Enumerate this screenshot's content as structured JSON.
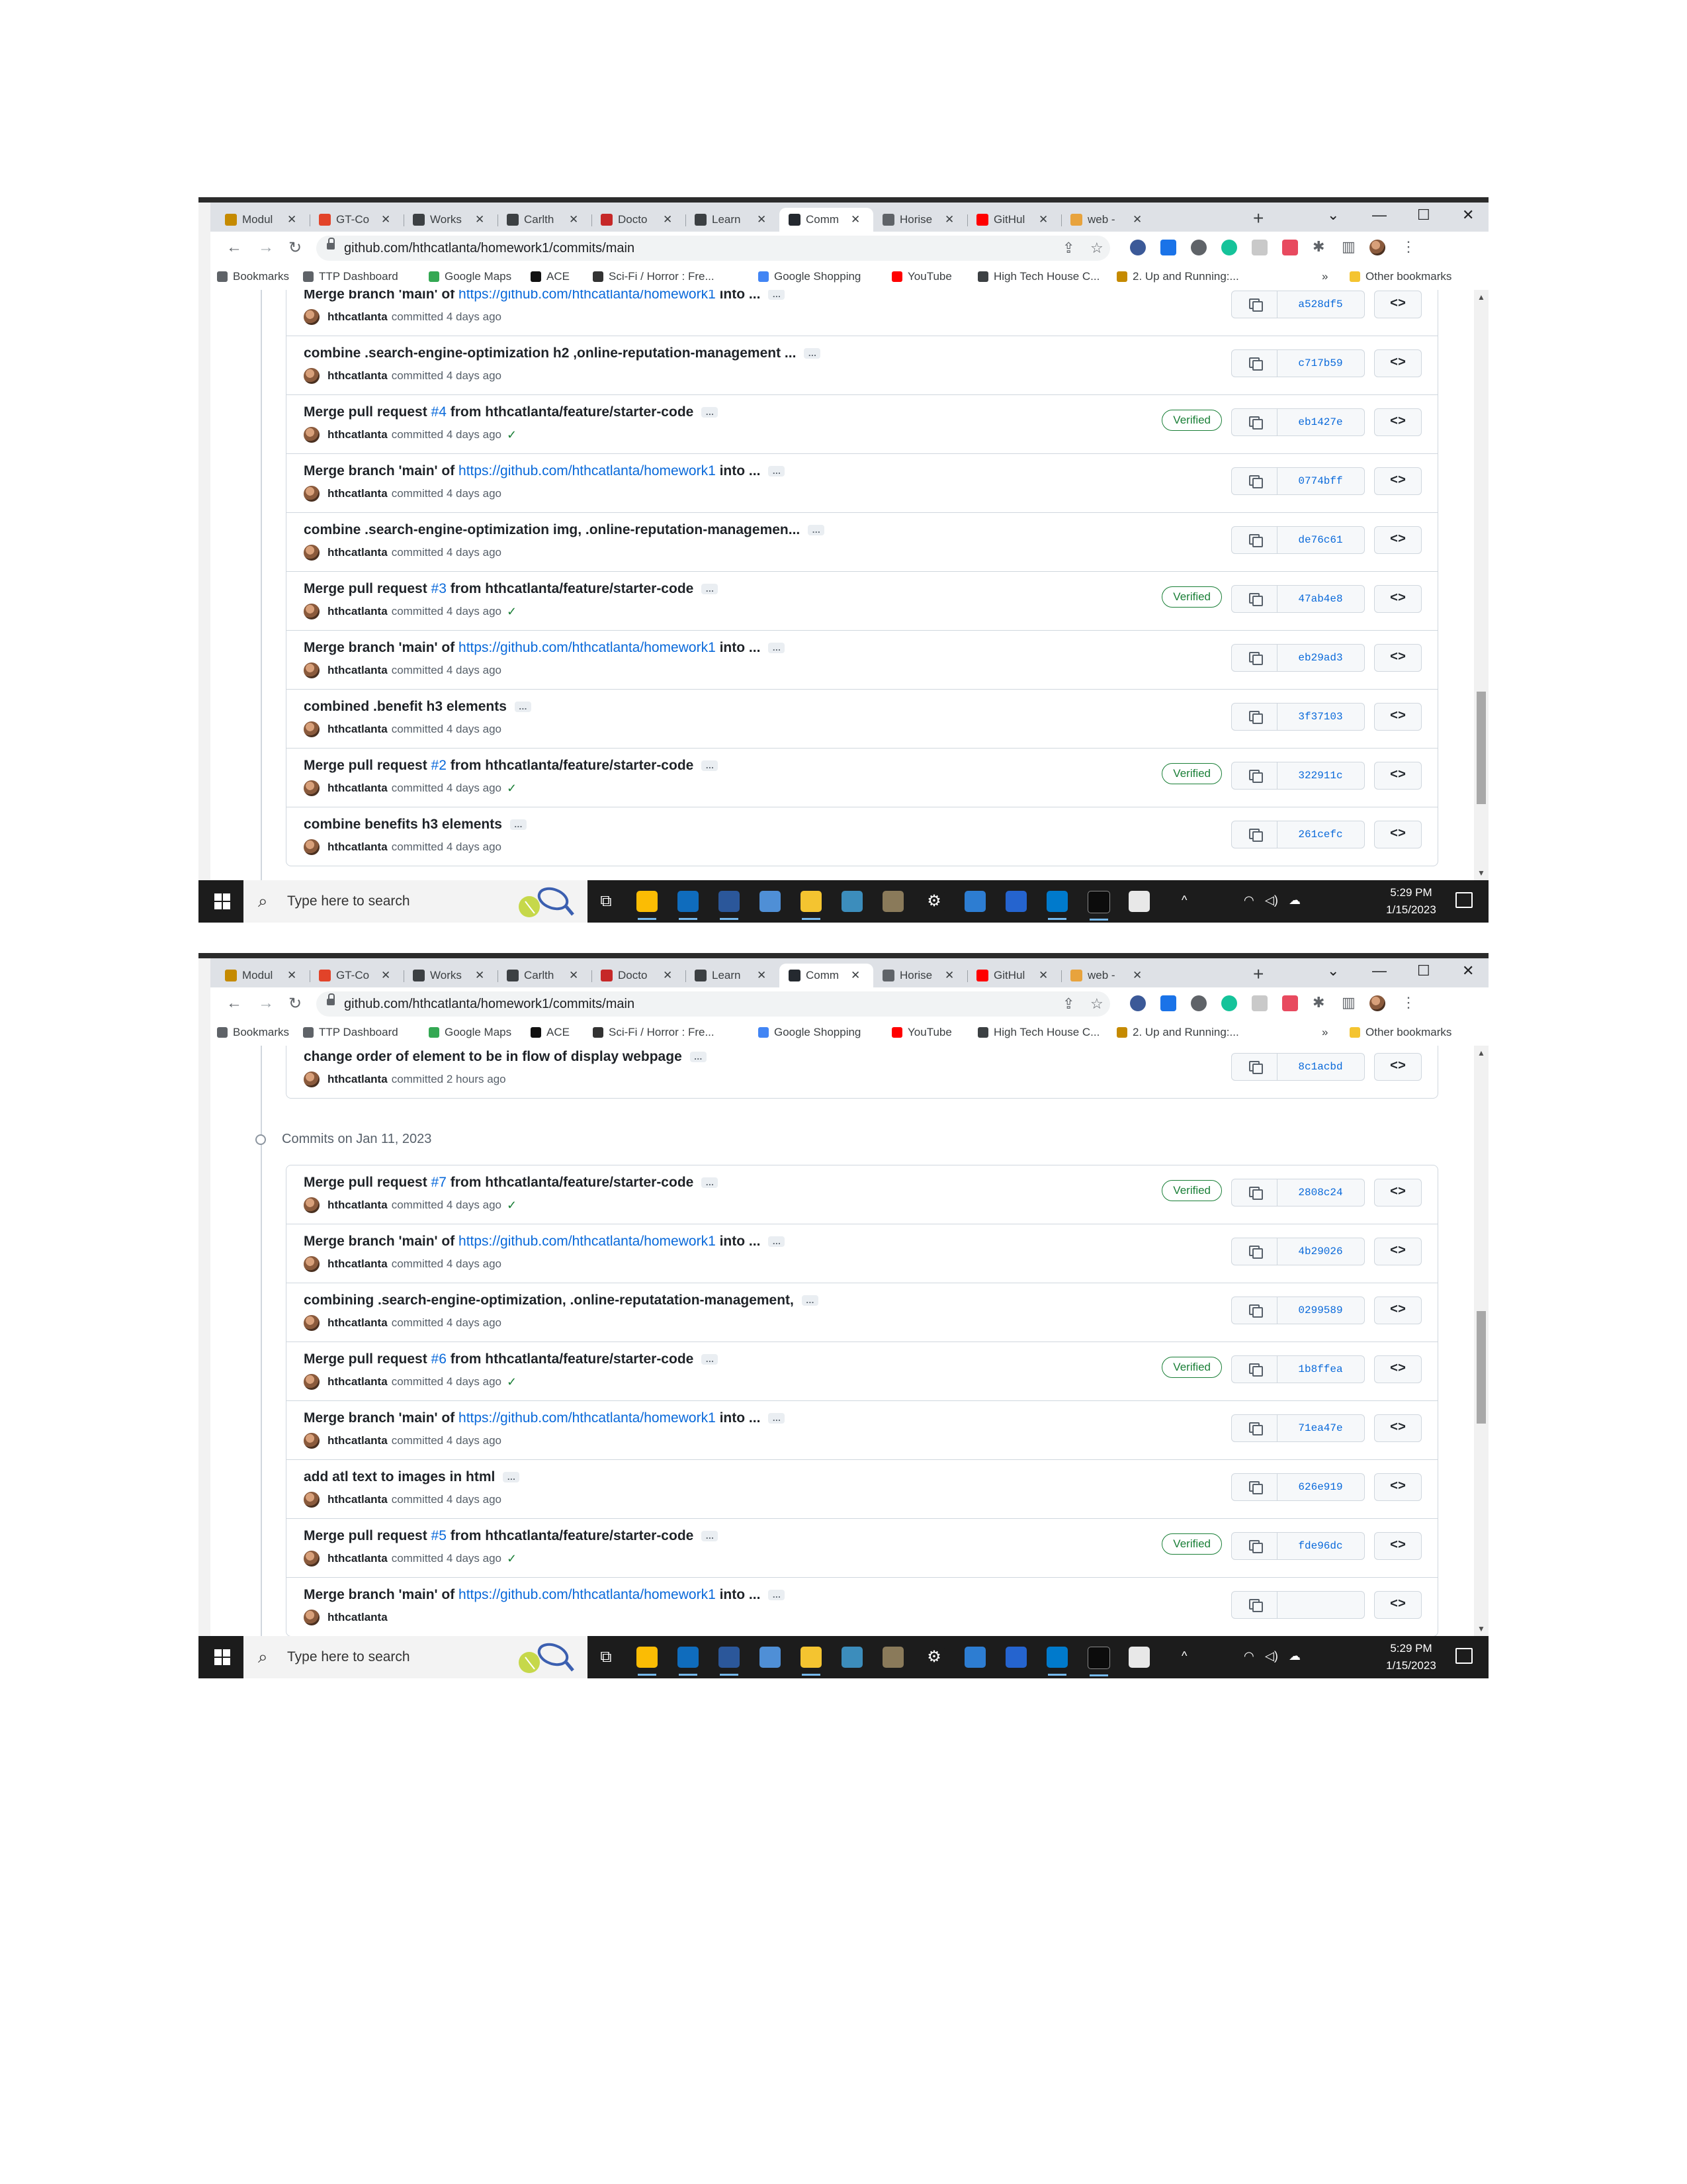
{
  "browser": {
    "tabs": [
      {
        "label": "Modul",
        "icon": "bee-icon",
        "color": "#c58a00"
      },
      {
        "label": "GT-Co",
        "icon": "gitlab-icon",
        "color": "#e24329"
      },
      {
        "label": "Works",
        "icon": "doc-icon",
        "color": "#3c4043"
      },
      {
        "label": "Carlth",
        "icon": "doc-icon",
        "color": "#3c4043"
      },
      {
        "label": "Docto",
        "icon": "red-leaf-icon",
        "color": "#c62828"
      },
      {
        "label": "Learn",
        "icon": "doc-icon",
        "color": "#3c4043"
      },
      {
        "label": "Comm",
        "icon": "github-icon",
        "color": "#24292f"
      },
      {
        "label": "Horise",
        "icon": "globe-icon",
        "color": "#5f6368"
      },
      {
        "label": "GitHul",
        "icon": "youtube-icon",
        "color": "#ff0000"
      },
      {
        "label": "web -",
        "icon": "pencil-icon",
        "color": "#e8a33d"
      }
    ],
    "url": "github.com/hthcatlanta/homework1/commits/main",
    "bookmarks": [
      {
        "label": "Bookmarks",
        "icon": "star-icon",
        "color": "#5f6368"
      },
      {
        "label": "TTP Dashboard",
        "icon": "gear-logo-icon",
        "color": "#5f6368"
      },
      {
        "label": "Google Maps",
        "icon": "map-pin-icon",
        "color": "#34a853"
      },
      {
        "label": "ACE",
        "icon": "w-logo-icon",
        "color": "#111111"
      },
      {
        "label": "Sci-Fi / Horror : Fre...",
        "icon": "film-icon",
        "color": "#333333"
      },
      {
        "label": "Google Shopping",
        "icon": "shopping-icon",
        "color": "#4285f4"
      },
      {
        "label": "YouTube",
        "icon": "youtube-icon",
        "color": "#ff0000"
      },
      {
        "label": "High Tech House C...",
        "icon": "wave-icon",
        "color": "#3c4043"
      },
      {
        "label": "2. Up and Running:...",
        "icon": "bee-icon",
        "color": "#c58a00"
      }
    ],
    "other_bookmarks": "Other bookmarks",
    "overflow": "»"
  },
  "screenshot1": {
    "commits": [
      {
        "pre": "Merge branch 'main' of ",
        "link": "https://github.com/hthcatlanta/homework1",
        "post": " into ...",
        "author": "hthcatlanta",
        "meta": "committed 4 days ago",
        "verified": false,
        "check": false,
        "sha": "a528df5"
      },
      {
        "pre": "combine .search-engine-optimization h2 ,online-reputation-management ...",
        "link": "",
        "post": "",
        "author": "hthcatlanta",
        "meta": "committed 4 days ago",
        "verified": false,
        "check": false,
        "sha": "c717b59"
      },
      {
        "pre": "Merge pull request ",
        "link": "#4",
        "post": " from hthcatlanta/feature/starter-code",
        "author": "hthcatlanta",
        "meta": "committed 4 days ago",
        "verified": true,
        "check": true,
        "sha": "eb1427e"
      },
      {
        "pre": "Merge branch 'main' of ",
        "link": "https://github.com/hthcatlanta/homework1",
        "post": " into ...",
        "author": "hthcatlanta",
        "meta": "committed 4 days ago",
        "verified": false,
        "check": false,
        "sha": "0774bff"
      },
      {
        "pre": "combine .search-engine-optimization img, .online-reputation-managemen...",
        "link": "",
        "post": "",
        "author": "hthcatlanta",
        "meta": "committed 4 days ago",
        "verified": false,
        "check": false,
        "sha": "de76c61"
      },
      {
        "pre": "Merge pull request ",
        "link": "#3",
        "post": " from hthcatlanta/feature/starter-code",
        "author": "hthcatlanta",
        "meta": "committed 4 days ago",
        "verified": true,
        "check": true,
        "sha": "47ab4e8"
      },
      {
        "pre": "Merge branch 'main' of ",
        "link": "https://github.com/hthcatlanta/homework1",
        "post": " into ...",
        "author": "hthcatlanta",
        "meta": "committed 4 days ago",
        "verified": false,
        "check": false,
        "sha": "eb29ad3"
      },
      {
        "pre": "combined .benefit h3 elements",
        "link": "",
        "post": "",
        "author": "hthcatlanta",
        "meta": "committed 4 days ago",
        "verified": false,
        "check": false,
        "sha": "3f37103"
      },
      {
        "pre": "Merge pull request ",
        "link": "#2",
        "post": " from hthcatlanta/feature/starter-code",
        "author": "hthcatlanta",
        "meta": "committed 4 days ago",
        "verified": true,
        "check": true,
        "sha": "322911c"
      },
      {
        "pre": "combine benefits h3 elements",
        "link": "",
        "post": "",
        "author": "hthcatlanta",
        "meta": "committed 4 days ago",
        "verified": false,
        "check": false,
        "sha": "261cefc"
      }
    ]
  },
  "screenshot2": {
    "top_commit": {
      "pre": "change order of element to be in flow of display webpage",
      "link": "",
      "post": "",
      "author": "hthcatlanta",
      "meta": "committed 2 hours ago",
      "verified": false,
      "check": false,
      "sha": "8c1acbd"
    },
    "date_heading": "Commits on Jan 11, 2023",
    "commits": [
      {
        "pre": "Merge pull request ",
        "link": "#7",
        "post": " from hthcatlanta/feature/starter-code",
        "author": "hthcatlanta",
        "meta": "committed 4 days ago",
        "verified": true,
        "check": true,
        "sha": "2808c24"
      },
      {
        "pre": "Merge branch 'main' of ",
        "link": "https://github.com/hthcatlanta/homework1",
        "post": " into ...",
        "author": "hthcatlanta",
        "meta": "committed 4 days ago",
        "verified": false,
        "check": false,
        "sha": "4b29026"
      },
      {
        "pre": "combining .search-engine-optimization, .online-reputatation-management,",
        "link": "",
        "post": "",
        "author": "hthcatlanta",
        "meta": "committed 4 days ago",
        "verified": false,
        "check": false,
        "sha": "0299589"
      },
      {
        "pre": "Merge pull request ",
        "link": "#6",
        "post": " from hthcatlanta/feature/starter-code",
        "author": "hthcatlanta",
        "meta": "committed 4 days ago",
        "verified": true,
        "check": true,
        "sha": "1b8ffea"
      },
      {
        "pre": "Merge branch 'main' of ",
        "link": "https://github.com/hthcatlanta/homework1",
        "post": " into ...",
        "author": "hthcatlanta",
        "meta": "committed 4 days ago",
        "verified": false,
        "check": false,
        "sha": "71ea47e"
      },
      {
        "pre": "add atl text to images in html",
        "link": "",
        "post": "",
        "author": "hthcatlanta",
        "meta": "committed 4 days ago",
        "verified": false,
        "check": false,
        "sha": "626e919"
      },
      {
        "pre": "Merge pull request ",
        "link": "#5",
        "post": " from hthcatlanta/feature/starter-code",
        "author": "hthcatlanta",
        "meta": "committed 4 days ago",
        "verified": true,
        "check": true,
        "sha": "fde96dc"
      },
      {
        "pre": "Merge branch 'main' of ",
        "link": "https://github.com/hthcatlanta/homework1",
        "post": " into ...",
        "author": "hthcatlanta",
        "meta": "",
        "verified": false,
        "check": false,
        "sha": ""
      }
    ]
  },
  "labels": {
    "verified": "Verified",
    "browse_code": "<>",
    "more": "…"
  },
  "taskbar": {
    "search_placeholder": "Type here to search",
    "time": "5:29 PM",
    "date": "1/15/2023"
  },
  "scroll": {
    "shot1_thumb_fraction_top": 0.68,
    "shot2_thumb_fraction_top": 0.45
  }
}
